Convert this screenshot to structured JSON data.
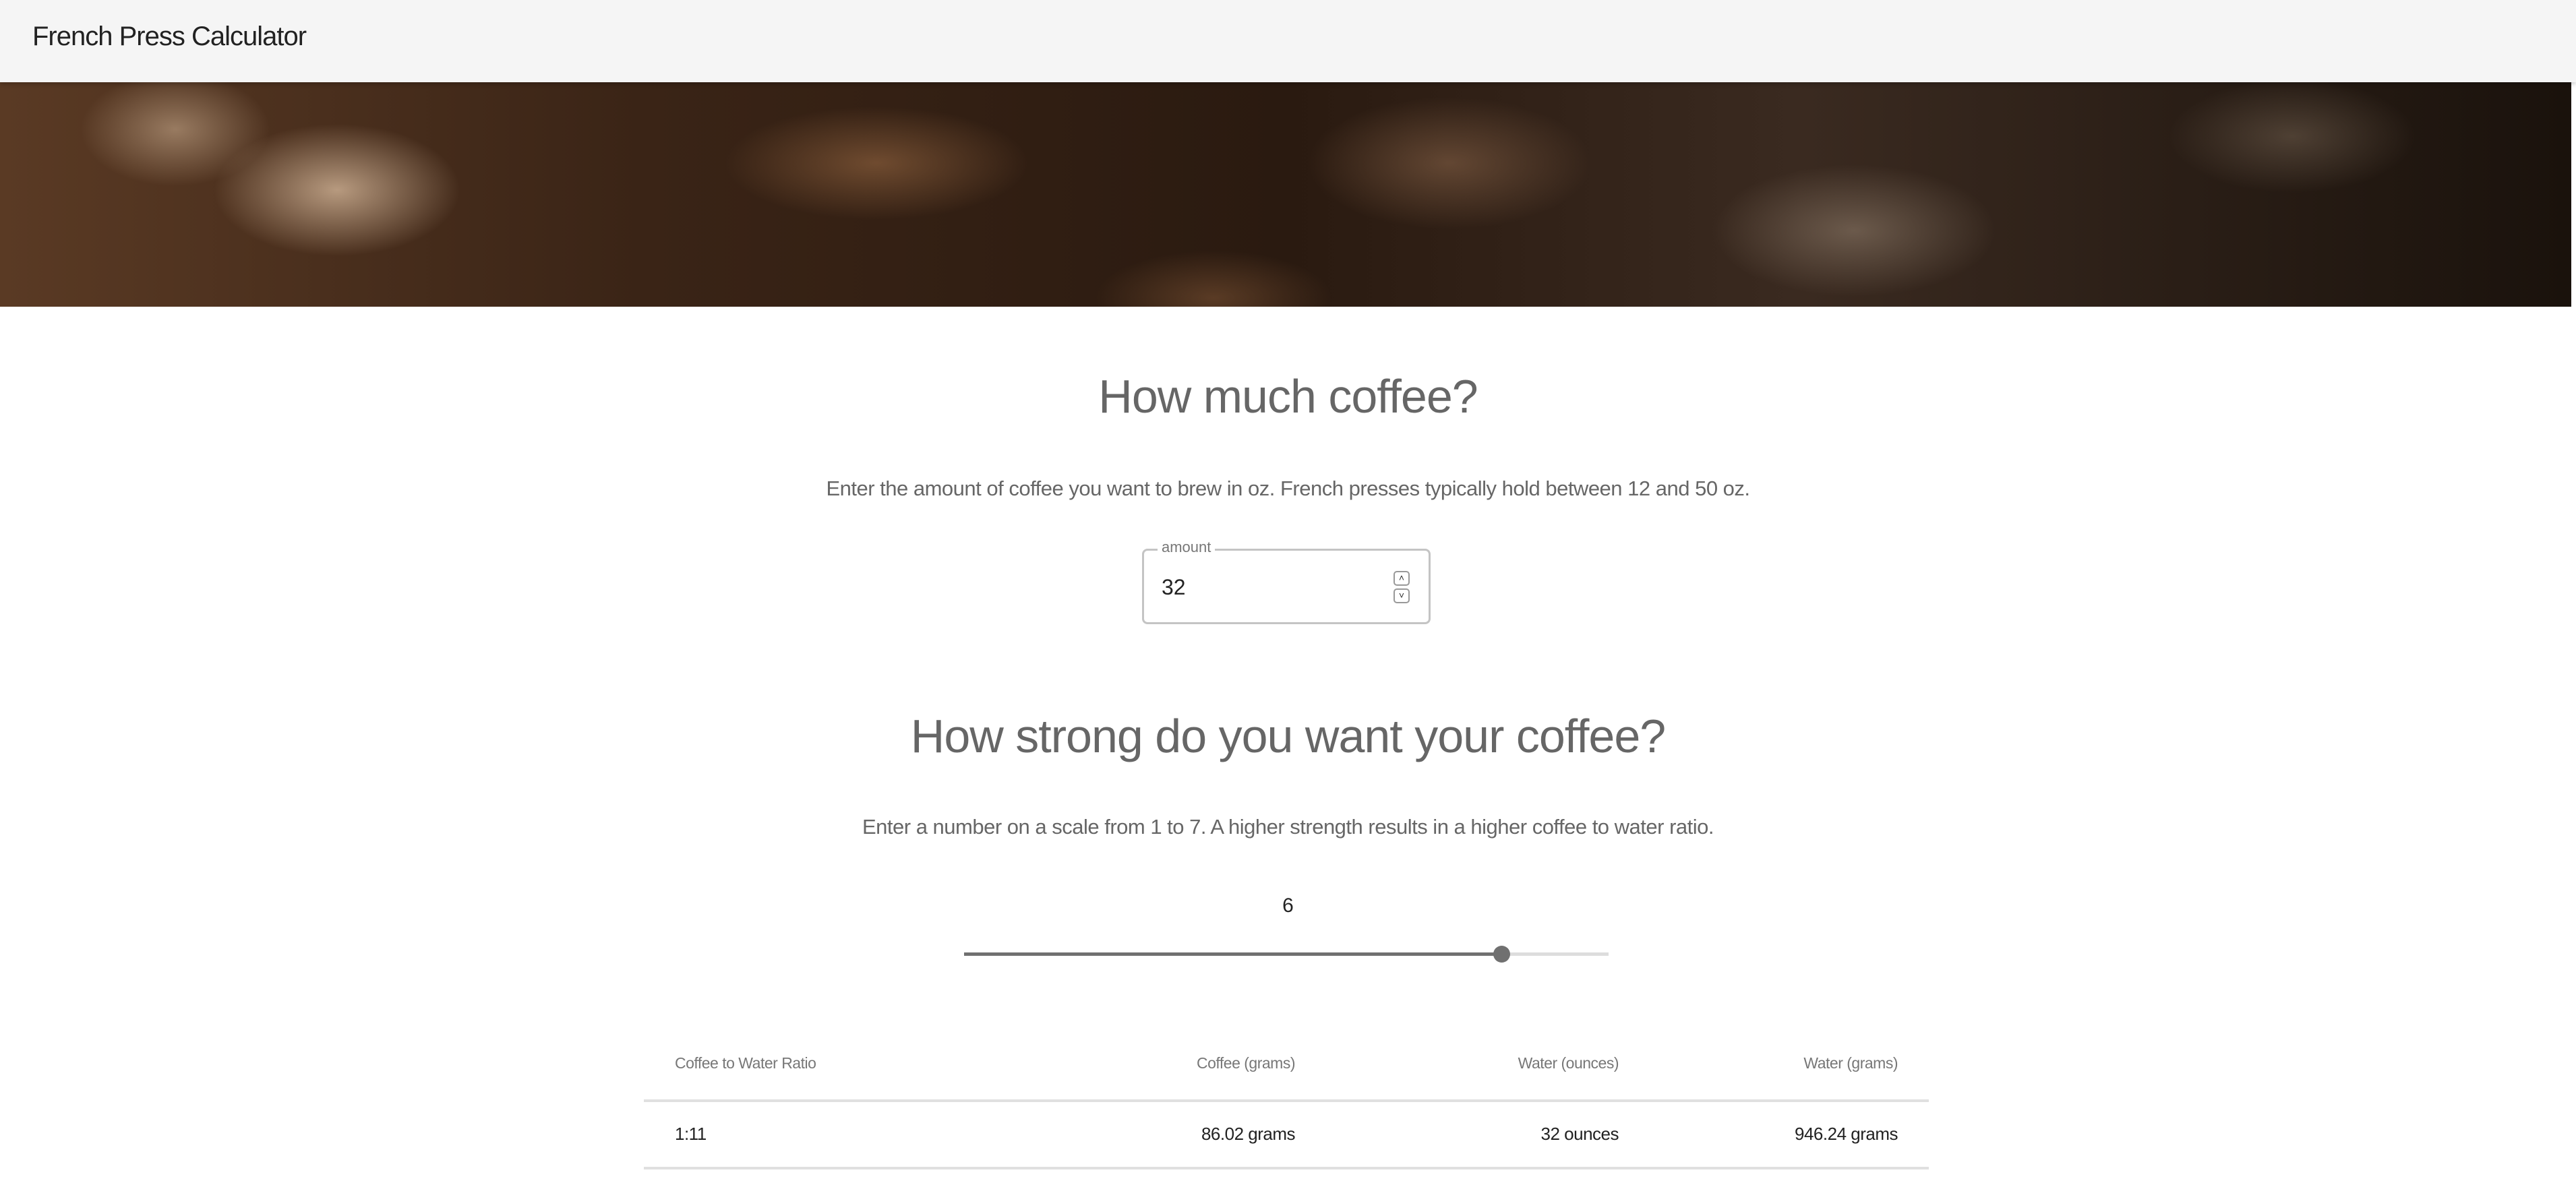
{
  "appbar": {
    "title": "French Press Calculator"
  },
  "amount_section": {
    "heading": "How much coffee?",
    "description": "Enter the amount of coffee you want to brew in oz. French presses typically hold between 12 and 50 oz.",
    "field_label": "amount",
    "field_value": "32"
  },
  "strength_section": {
    "heading": "How strong do you want your coffee?",
    "description": "Enter a number on a scale from 1 to 7. A higher strength results in a higher coffee to water ratio.",
    "value": "6",
    "min": 1,
    "max": 7
  },
  "table": {
    "headers": [
      "Coffee to Water Ratio",
      "Coffee (grams)",
      "Water (ounces)",
      "Water (grams)"
    ],
    "rows": [
      [
        "1:11",
        "86.02 grams",
        "32 ounces",
        "946.24 grams"
      ]
    ]
  },
  "colors": {
    "appbar": "#f5f5f5",
    "slider": "#707070",
    "text": "#666666"
  }
}
